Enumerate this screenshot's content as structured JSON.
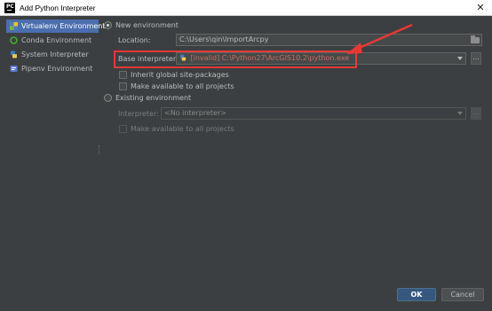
{
  "window": {
    "title": "Add Python Interpreter",
    "close_glyph": "✕"
  },
  "sidebar": {
    "items": [
      {
        "label": "Virtualenv Environment",
        "icon": "virtualenv-icon",
        "selected": true
      },
      {
        "label": "Conda Environment",
        "icon": "conda-icon"
      },
      {
        "label": "System Interpreter",
        "icon": "python-icon"
      },
      {
        "label": "Pipenv Environment",
        "icon": "pipenv-icon"
      }
    ]
  },
  "new_env": {
    "radio_label": "New environment",
    "location_label": "Location:",
    "location_value": "C:\\Users\\qin\\ImportArcpy",
    "base_label": "Base interpreter:",
    "base_invalid": "[invalid]",
    "base_path": "C:\\Python27\\ArcGIS10.2\\python.exe",
    "inherit_label": "Inherit global site-packages",
    "available_label": "Make available to all projects",
    "more": "..."
  },
  "existing_env": {
    "radio_label": "Existing environment",
    "interpreter_label": "Interpreter:",
    "interpreter_value": "<No interpreter>",
    "available_label": "Make available to all projects",
    "more": "..."
  },
  "buttons": {
    "ok": "OK",
    "cancel": "Cancel"
  },
  "colors": {
    "annotation": "#e53935",
    "selection": "#4b6eaf",
    "ok": "#365880"
  }
}
